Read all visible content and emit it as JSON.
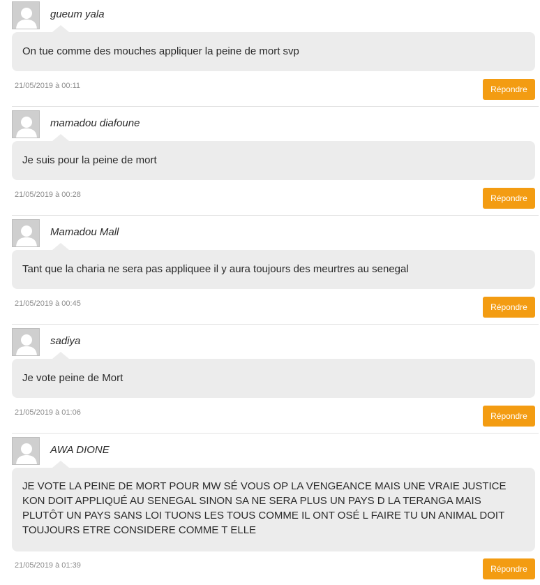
{
  "comments": [
    {
      "author": "gueum yala",
      "text": "On tue comme des mouches appliquer la peine de mort svp",
      "date": "21/05/2019 à 00:11",
      "reply_label": "Répondre"
    },
    {
      "author": "mamadou diafoune",
      "text": "Je suis pour la peine de mort",
      "date": "21/05/2019 à 00:28",
      "reply_label": "Répondre"
    },
    {
      "author": "Mamadou Mall",
      "text": "Tant que la charia ne sera pas appliquee il y aura toujours des meurtres au senegal",
      "date": "21/05/2019 à 00:45",
      "reply_label": "Répondre"
    },
    {
      "author": "sadiya",
      "text": "Je vote peine de Mort",
      "date": "21/05/2019 à 01:06",
      "reply_label": "Répondre"
    },
    {
      "author": "AWA DIONE",
      "text": "JE VOTE LA PEINE DE MORT POUR MW SÉ VOUS OP LA VENGEANCE MAIS UNE VRAIE JUSTICE KON DOIT APPLIQUÉ AU SENEGAL SINON SA NE SERA PLUS UN PAYS D LA TERANGA MAIS PLUTÔT UN PAYS SANS LOI TUONS LES TOUS COMME IL ONT OSÉ L FAIRE TU UN ANIMAL DOIT TOUJOURS ETRE CONSIDERE COMME T ELLE",
      "date": "21/05/2019 à 01:39",
      "reply_label": "Répondre"
    }
  ],
  "icons": {
    "avatar": "default-user-avatar-icon"
  },
  "colors": {
    "reply_button": "#f39c12",
    "bubble_background": "#ececec",
    "avatar_background": "#cfcfcf"
  }
}
